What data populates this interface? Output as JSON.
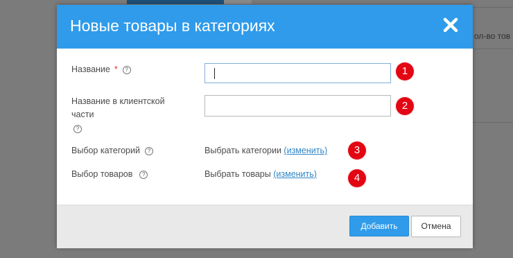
{
  "background": {
    "partial_column_text": "ол-во тов"
  },
  "modal": {
    "title": "Новые товары в категориях",
    "fields": {
      "name": {
        "label": "Название",
        "required_mark": "*",
        "value": ""
      },
      "client_name": {
        "label_line1": "Название в клиентской",
        "label_line2": "части",
        "value": ""
      },
      "categories": {
        "label": "Выбор категорий",
        "value": "Выбрать категории",
        "change_link": "(изменить)"
      },
      "products": {
        "label": "Выбор товаров",
        "value": "Выбрать товары",
        "change_link": "(изменить)"
      }
    },
    "help_glyph": "?",
    "badges": [
      "1",
      "2",
      "3",
      "4"
    ],
    "buttons": {
      "add": "Добавить",
      "cancel": "Отмена"
    }
  },
  "colors": {
    "header": "#2f9bea",
    "primary_button": "#2f9bea",
    "badge": "#e30613",
    "link": "#2f86c8",
    "required": "#e0342c"
  }
}
